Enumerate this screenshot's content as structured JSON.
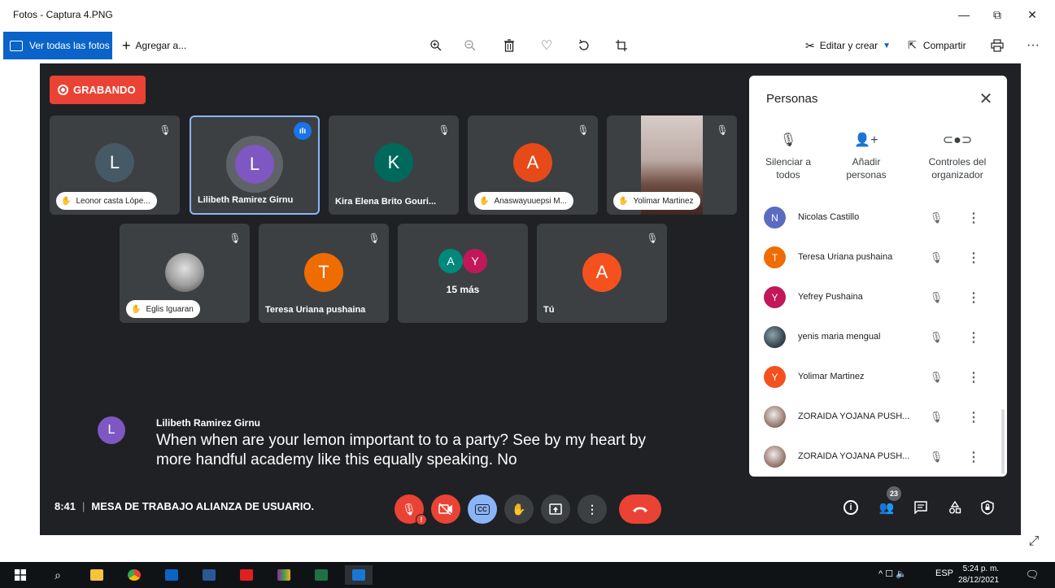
{
  "window": {
    "title": "Fotos - Captura 4.PNG",
    "minimize": "—",
    "maximize": "⧉",
    "close": "✕"
  },
  "toolbar": {
    "all_photos": "Ver todas las fotos",
    "add_to": "Agregar a...",
    "edit_create": "Editar y crear",
    "share": "Compartir",
    "more": "···"
  },
  "meet": {
    "recording": "GRABANDO",
    "tiles_row1": [
      {
        "name": "Leonor casta Lópe...",
        "initial": "L",
        "color": "#455a64",
        "style": "pill"
      },
      {
        "name": "Lilibeth Ramirez Girnu",
        "initial": "L",
        "color": "#7e57c2",
        "style": "plain",
        "speaking": true
      },
      {
        "name": "Kira Elena Brito Gouri...",
        "initial": "K",
        "color": "#00695c",
        "style": "plain"
      },
      {
        "name": "Anaswayuuepsi M...",
        "initial": "A",
        "color": "#e64a19",
        "style": "pill"
      },
      {
        "name": "Yolimar Martinez",
        "initial": "",
        "color": "#8d6e63",
        "style": "pill",
        "photo": true
      }
    ],
    "tiles_row2": [
      {
        "name": "Eglis Iguaran",
        "initial": "",
        "color": "#9e9e9e",
        "style": "pill",
        "photo": true
      },
      {
        "name": "Teresa Uriana pushaina",
        "initial": "T",
        "color": "#ef6c00",
        "style": "plain"
      },
      {
        "name": "15 más",
        "style": "group",
        "initials": [
          "A",
          "Y"
        ],
        "colors": [
          "#00897b",
          "#c2185b"
        ]
      },
      {
        "name": "Tú",
        "initial": "A",
        "color": "#f4511e",
        "style": "plain"
      }
    ],
    "caption": {
      "speaker_initial": "L",
      "speaker": "Lilibeth Ramirez Girnu",
      "text": "When when are your lemon important to to a party? See by my heart by more handful academy like this equally speaking. No"
    },
    "time": "8:41",
    "meeting_name": "MESA DE TRABAJO ALIANZA DE USUARIO.",
    "participant_count": "23"
  },
  "panel": {
    "title": "Personas",
    "actions": [
      {
        "label": "Silenciar a todos",
        "line1": "Silenciar a",
        "line2": "todos"
      },
      {
        "label": "Añadir personas",
        "line1": "Añadir",
        "line2": "personas"
      },
      {
        "label": "Controles del organizador",
        "line1": "Controles del",
        "line2": "organizador"
      }
    ],
    "people": [
      {
        "name": "Nicolas Castillo",
        "initial": "N",
        "color": "#5c6bc0"
      },
      {
        "name": "Teresa Uriana pushaina",
        "initial": "T",
        "color": "#ef6c00"
      },
      {
        "name": "Yefrey Pushaina",
        "initial": "Y",
        "color": "#c2185b"
      },
      {
        "name": "yenis maria mengual",
        "initial": "",
        "color": "#37474f",
        "photo": true
      },
      {
        "name": "Yolimar Martinez",
        "initial": "Y",
        "color": "#f4511e"
      },
      {
        "name": "ZORAIDA YOJANA PUSH...",
        "initial": "",
        "color": "#a1887f",
        "photo": true
      },
      {
        "name": "ZORAIDA YOJANA PUSH...",
        "initial": "",
        "color": "#a1887f",
        "photo": true
      }
    ]
  },
  "taskbar": {
    "language": "ESP",
    "time": "5:24 p. m.",
    "date": "28/12/2021"
  }
}
